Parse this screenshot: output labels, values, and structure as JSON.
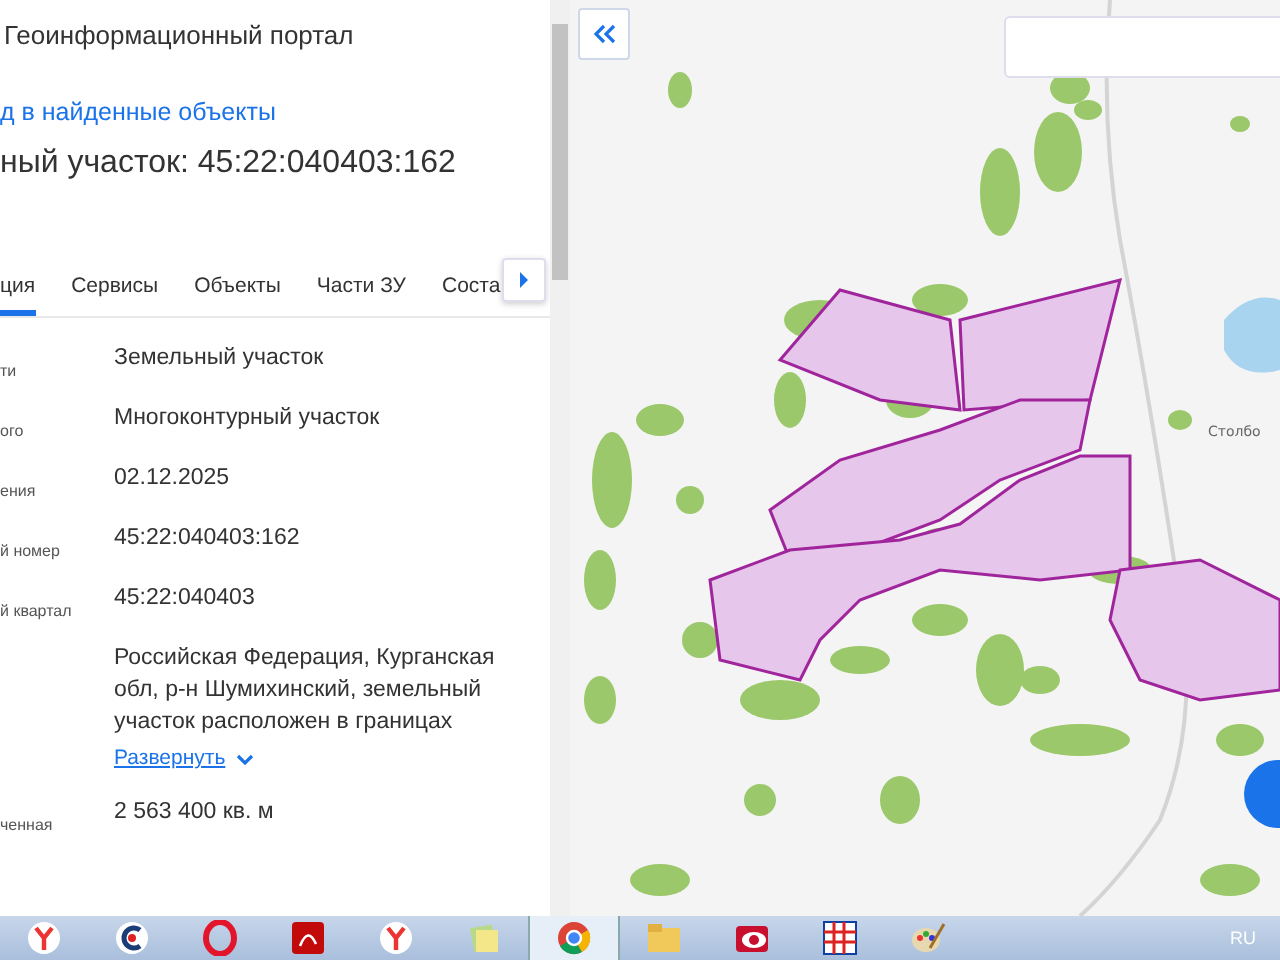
{
  "header": {
    "title": "Геоинформационный портал",
    "back_link": "д в найденные объекты",
    "heading": "ный участок: 45:22:040403:162"
  },
  "tabs": [
    {
      "label": "ция",
      "selected": true
    },
    {
      "label": "Сервисы",
      "selected": false
    },
    {
      "label": "Объекты",
      "selected": false
    },
    {
      "label": "Части ЗУ",
      "selected": false
    },
    {
      "label": "Соста",
      "selected": false
    }
  ],
  "fields": [
    {
      "label": "ти",
      "value": "Земельный участок"
    },
    {
      "label": "ого",
      "value": "Многоконтурный участок"
    },
    {
      "label": "ения",
      "value": "02.12.2025"
    },
    {
      "label": "й номер",
      "value": "45:22:040403:162"
    },
    {
      "label": "й квартал",
      "value": "45:22:040403"
    },
    {
      "value": "Российская Федерация, Курганская обл, р-н Шумихинский, земельный участок расположен в границах",
      "expand_link": "Развернуть"
    },
    {
      "label": "ченная",
      "value": "2 563 400 кв. м"
    }
  ],
  "map": {
    "place_label": "Столбо"
  },
  "taskbar": {
    "icons": [
      {
        "kind": "yandex",
        "selected": false
      },
      {
        "kind": "ccleaner",
        "selected": false
      },
      {
        "kind": "opera",
        "selected": false
      },
      {
        "kind": "pdf",
        "selected": false
      },
      {
        "kind": "yandex",
        "selected": false
      },
      {
        "kind": "notes",
        "selected": false
      },
      {
        "kind": "chrome",
        "selected": true
      },
      {
        "kind": "folder",
        "selected": false
      },
      {
        "kind": "eye",
        "selected": false
      },
      {
        "kind": "calendar",
        "selected": false
      },
      {
        "kind": "paint",
        "selected": false
      }
    ],
    "language": "RU"
  }
}
